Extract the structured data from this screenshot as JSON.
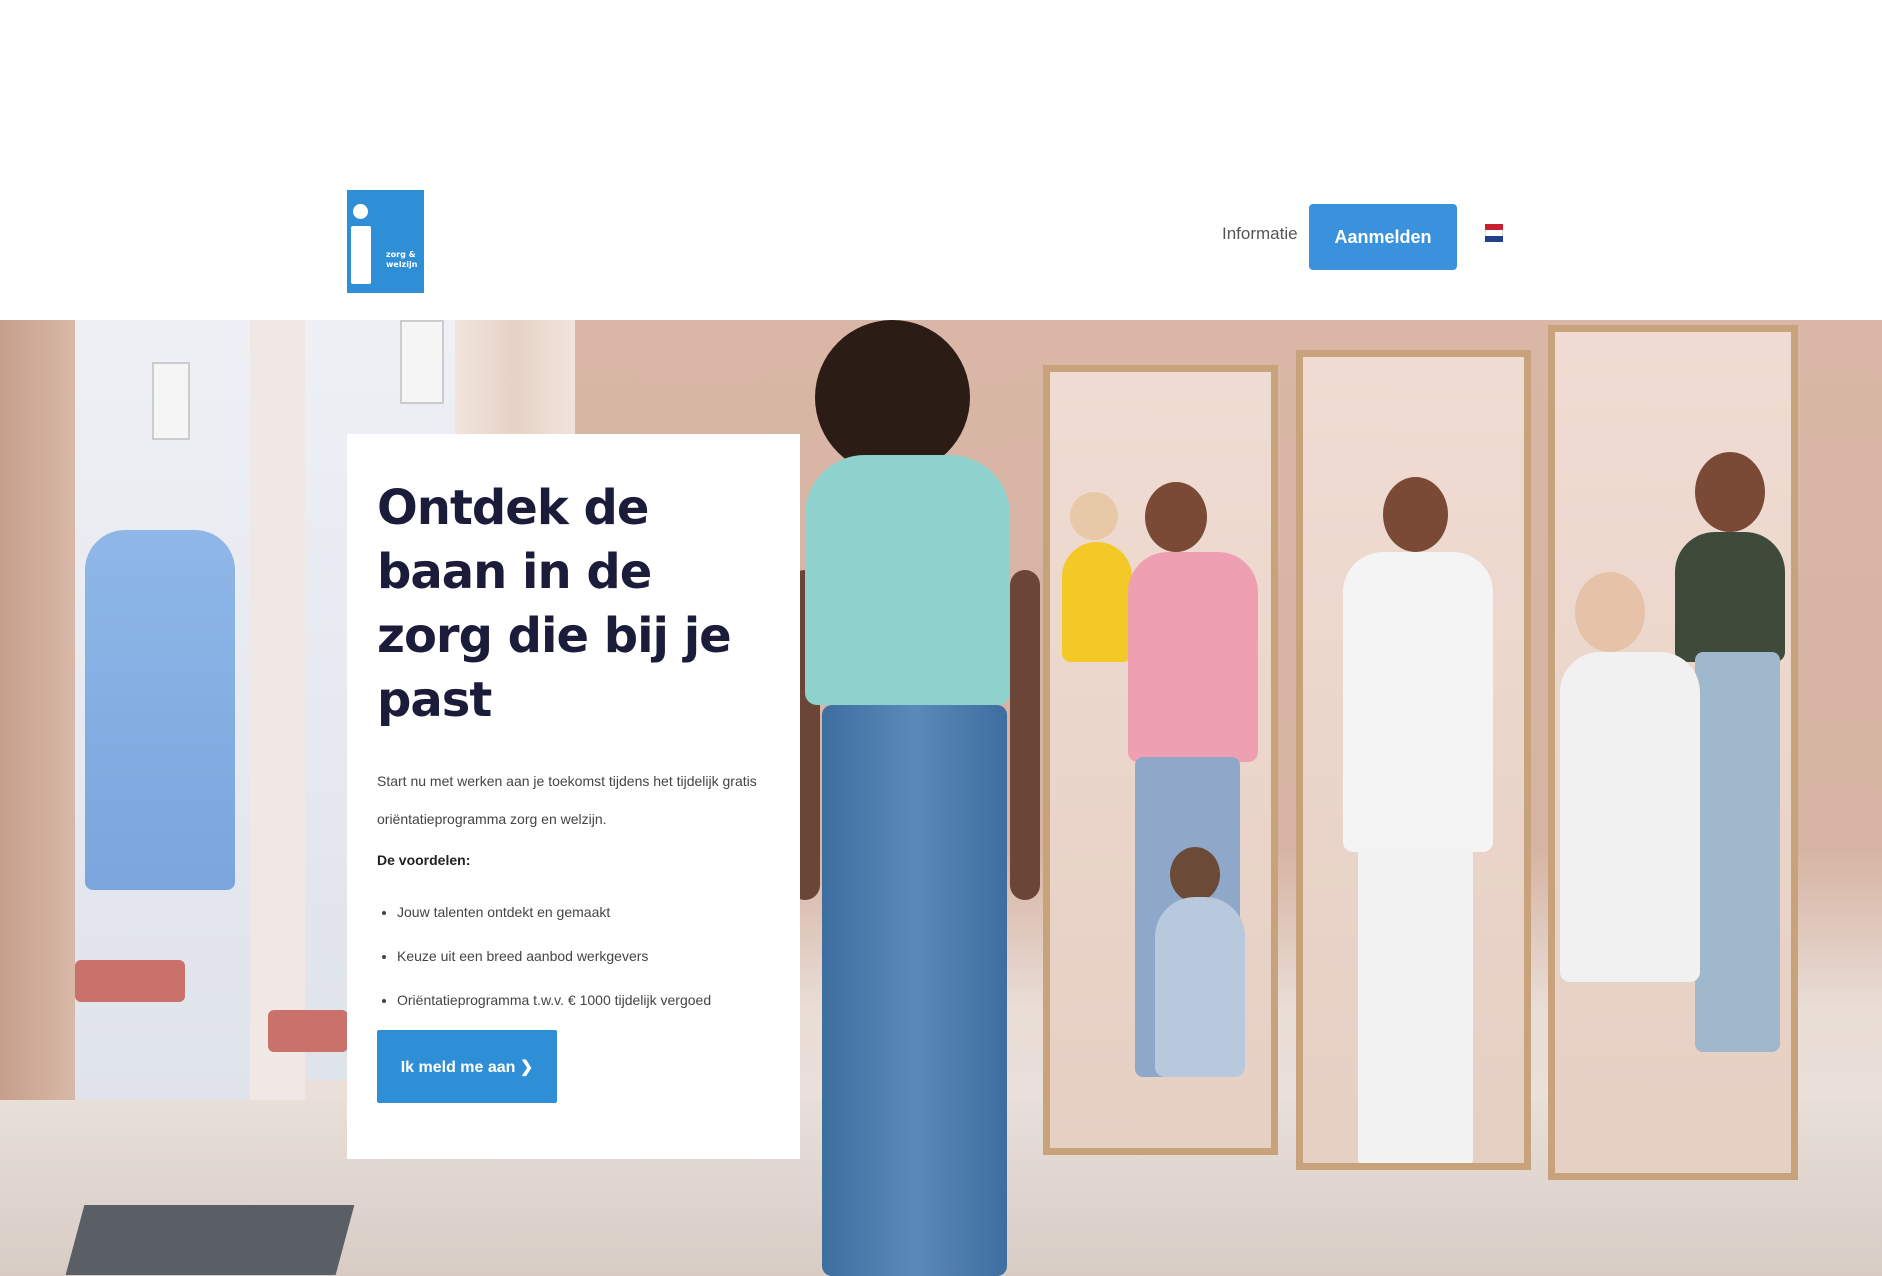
{
  "header": {
    "logo_text": "zorg & welzijn",
    "nav_info_label": "Informatie",
    "signup_label": "Aanmelden",
    "language": "NL"
  },
  "hero": {
    "title": "Ontdek de baan in de zorg die bij je past",
    "intro": "Start nu met werken aan je toekomst tijdens het tijdelijk gratis oriëntatieprogramma zorg en welzijn.",
    "benefits_title": "De voordelen:",
    "benefits": [
      "Jouw talenten ontdekt en gemaakt",
      "Keuze uit een breed aanbod werkgevers",
      "Oriëntatieprogramma t.w.v. € 1000 tijdelijk vergoed"
    ],
    "cta_label": "Ik meld me aan ❯"
  },
  "colors": {
    "brand_blue": "#2f8fd6",
    "title_navy": "#1b1b3a"
  },
  "icons": [
    "logo-icon",
    "flag-nl-icon",
    "chevron-right-icon"
  ]
}
